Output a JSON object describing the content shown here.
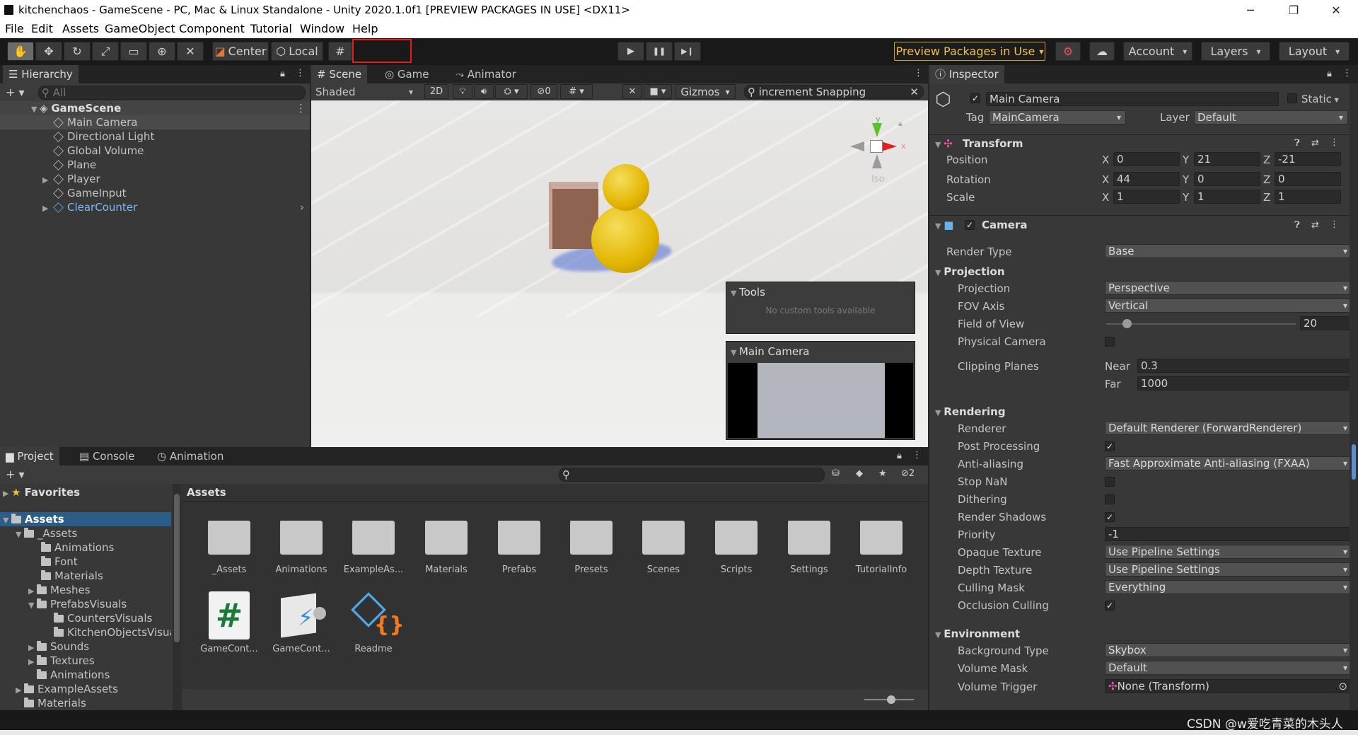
{
  "window": {
    "title": "kitchenchaos - GameScene - PC, Mac & Linux Standalone - Unity 2020.1.0f1 [PREVIEW PACKAGES IN USE] <DX11>",
    "minimize": "─",
    "maximize": "❐",
    "close": "✕"
  },
  "menu": [
    "File",
    "Edit",
    "Assets",
    "GameObject",
    "Component",
    "Tutorial",
    "Window",
    "Help"
  ],
  "toolbar": {
    "center": "Center",
    "local": "Local",
    "play": "▶",
    "pause": "❚❚",
    "step": "▶❙",
    "preview": "Preview Packages in Use",
    "account": "Account",
    "layers": "Layers",
    "layout": "Layout"
  },
  "hierarchy": {
    "tab": "Hierarchy",
    "search_placeholder": "All",
    "scene": "GameScene",
    "items": [
      "Main Camera",
      "Directional Light",
      "Global Volume",
      "Plane",
      "Player",
      "GameInput",
      "ClearCounter"
    ]
  },
  "scene": {
    "tabs": [
      "Scene",
      "Game",
      "Animator"
    ],
    "shading": "Shaded",
    "mode2d": "2D",
    "hidden_count": "0",
    "gizmos": "Gizmos",
    "search_value": "increment Snapping",
    "iso": "Iso",
    "gizmo_y": "y",
    "gizmo_x": "x",
    "tools_title": "Tools",
    "tools_msg": "No custom tools available",
    "camera_title": "Main Camera"
  },
  "project": {
    "tabs": [
      "Project",
      "Console",
      "Animation"
    ],
    "favorites": "Favorites",
    "assets_root": "Assets",
    "hidden_count": "2",
    "breadcrumb": "Assets",
    "tree": [
      "_Assets",
      "Animations",
      "Font",
      "Materials",
      "Meshes",
      "PrefabsVisuals",
      "CountersVisuals",
      "KitchenObjectsVisuals",
      "Sounds",
      "Textures",
      "Animations",
      "ExampleAssets",
      "Materials"
    ],
    "folders": [
      "_Assets",
      "Animations",
      "ExampleAs...",
      "Materials",
      "Prefabs",
      "Presets",
      "Scenes",
      "Scripts",
      "Settings",
      "TutorialInfo"
    ],
    "files": [
      "GameCont...",
      "GameCont...",
      "Readme"
    ]
  },
  "inspector": {
    "tab": "Inspector",
    "name": "Main Camera",
    "static": "Static",
    "tag_label": "Tag",
    "tag": "MainCamera",
    "layer_label": "Layer",
    "layer": "Default",
    "transform": {
      "title": "Transform",
      "position_label": "Position",
      "rotation_label": "Rotation",
      "scale_label": "Scale",
      "x": "X",
      "y": "Y",
      "z": "Z",
      "position": [
        "0",
        "21",
        "-21"
      ],
      "rotation": [
        "44",
        "0",
        "0"
      ],
      "scale": [
        "1",
        "1",
        "1"
      ]
    },
    "camera": {
      "title": "Camera",
      "render_type_label": "Render Type",
      "render_type": "Base",
      "projection_head": "Projection",
      "projection_label": "Projection",
      "projection": "Perspective",
      "fov_axis_label": "FOV Axis",
      "fov_axis": "Vertical",
      "fov_label": "Field of View",
      "fov": "20",
      "fov_fraction": 0.11,
      "physical_label": "Physical Camera",
      "clipping_label": "Clipping Planes",
      "near_label": "Near",
      "near": "0.3",
      "far_label": "Far",
      "far": "1000",
      "rendering_head": "Rendering",
      "renderer_label": "Renderer",
      "renderer": "Default Renderer (ForwardRenderer)",
      "post_label": "Post Processing",
      "aa_label": "Anti-aliasing",
      "aa": "Fast Approximate Anti-aliasing (FXAA)",
      "stopnan_label": "Stop NaN",
      "dither_label": "Dithering",
      "shadows_label": "Render Shadows",
      "priority_label": "Priority",
      "priority": "-1",
      "opaque_label": "Opaque Texture",
      "opaque": "Use Pipeline Settings",
      "depth_label": "Depth Texture",
      "depth": "Use Pipeline Settings",
      "culling_label": "Culling Mask",
      "culling": "Everything",
      "occlusion_label": "Occlusion Culling",
      "env_head": "Environment",
      "bg_label": "Background Type",
      "bg": "Skybox",
      "vmask_label": "Volume Mask",
      "vmask": "Default",
      "vtrigger_label": "Volume Trigger",
      "vtrigger": "None (Transform)"
    }
  },
  "watermark": "CSDN @w爱吃青菜的木头人"
}
